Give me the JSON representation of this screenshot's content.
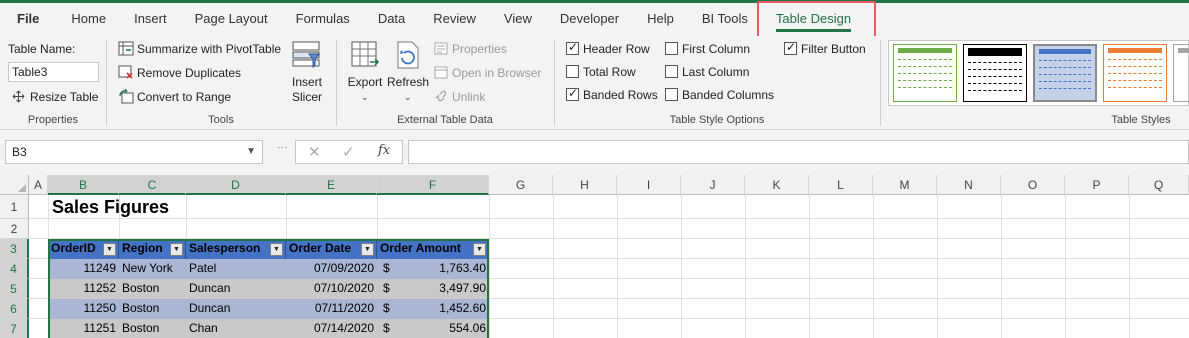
{
  "ribbon_tabs": [
    {
      "label": "File"
    },
    {
      "label": "Home"
    },
    {
      "label": "Insert"
    },
    {
      "label": "Page Layout"
    },
    {
      "label": "Formulas"
    },
    {
      "label": "Data"
    },
    {
      "label": "Review"
    },
    {
      "label": "View"
    },
    {
      "label": "Developer"
    },
    {
      "label": "Help"
    },
    {
      "label": "BI Tools"
    },
    {
      "label": "Table Design",
      "active": true
    }
  ],
  "properties": {
    "table_name_label": "Table Name:",
    "table_name_value": "Table3",
    "resize_label": "Resize Table",
    "group_label": "Properties"
  },
  "tools": {
    "summarize_label": "Summarize with PivotTable",
    "remove_dup_label": "Remove Duplicates",
    "convert_label": "Convert to Range",
    "insert_slicer_line1": "Insert",
    "insert_slicer_line2": "Slicer",
    "group_label": "Tools"
  },
  "external": {
    "export_label": "Export",
    "refresh_label": "Refresh",
    "properties_label": "Properties",
    "open_browser_label": "Open in Browser",
    "unlink_label": "Unlink",
    "group_label": "External Table Data"
  },
  "style_options": {
    "header_row": {
      "label": "Header Row",
      "checked": true
    },
    "total_row": {
      "label": "Total Row",
      "checked": false
    },
    "banded_rows": {
      "label": "Banded Rows",
      "checked": true
    },
    "first_column": {
      "label": "First Column",
      "checked": false
    },
    "last_column": {
      "label": "Last Column",
      "checked": false
    },
    "banded_columns": {
      "label": "Banded Columns",
      "checked": false
    },
    "filter_button": {
      "label": "Filter Button",
      "checked": true
    },
    "group_label": "Table Style Options"
  },
  "table_styles": {
    "group_label": "Table Styles",
    "swatch_colors": [
      "#70ad47",
      "#000000",
      "#4472c4",
      "#ed7d31",
      "#a5a5a5"
    ]
  },
  "formula_bar": {
    "name_box": "B3",
    "formula": ""
  },
  "grid": {
    "columns": [
      "A",
      "B",
      "C",
      "D",
      "E",
      "F",
      "G",
      "H",
      "I",
      "J",
      "K",
      "L",
      "M",
      "N",
      "O",
      "P",
      "Q"
    ],
    "rows": [
      "1",
      "2",
      "3",
      "4",
      "5",
      "6",
      "7"
    ],
    "title": "Sales Figures",
    "headers": [
      "OrderID",
      "Region",
      "Salesperson",
      "Order Date",
      "Order Amount"
    ],
    "data": [
      [
        "11249",
        "New York",
        "Patel",
        "07/09/2020",
        "$",
        "1,763.40"
      ],
      [
        "11252",
        "Boston",
        "Duncan",
        "07/10/2020",
        "$",
        "3,497.90"
      ],
      [
        "11250",
        "Boston",
        "Duncan",
        "07/11/2020",
        "$",
        "1,452.60"
      ],
      [
        "11251",
        "Boston",
        "Chan",
        "07/14/2020",
        "$",
        "554.06"
      ]
    ]
  },
  "colors": {
    "accent": "#217346",
    "header_fill": "#4472c4",
    "band_a": "#a9b7d4",
    "band_b": "#c9c9c9",
    "tab_highlight": "#e85a5a"
  }
}
